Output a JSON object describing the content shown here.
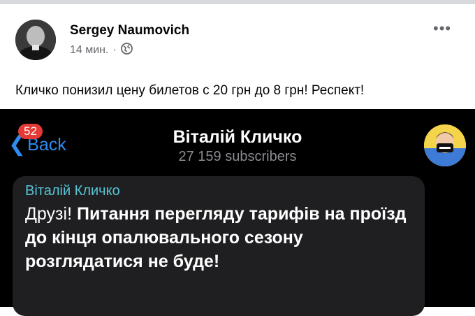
{
  "post": {
    "author": "Sergey Naumovich",
    "time": "14 мин.",
    "separator": "·",
    "privacy_icon": "globe-icon",
    "more_icon": "more-dots-icon",
    "more_label": "•••",
    "text": "Кличко понизил цену билетов с 20 грн до 8 грн! Респект!"
  },
  "telegram": {
    "back_label": "Back",
    "back_chevron": "❮",
    "unread_badge": "52",
    "channel_title": "Віталій Кличко",
    "subscribers": "27 159 subscribers",
    "message": {
      "author": "Віталій Кличко",
      "text_plain": "Друзі! ",
      "text_bold": "Питання перегляду тарифів на проїзд до кінця опалювального сезону розглядатися не буде!"
    }
  },
  "colors": {
    "telegram_bg": "#000000",
    "bubble_bg": "#1f1f21",
    "link_blue": "#2f8bef",
    "author_teal": "#56c5d6",
    "badge_red": "#e53935"
  }
}
